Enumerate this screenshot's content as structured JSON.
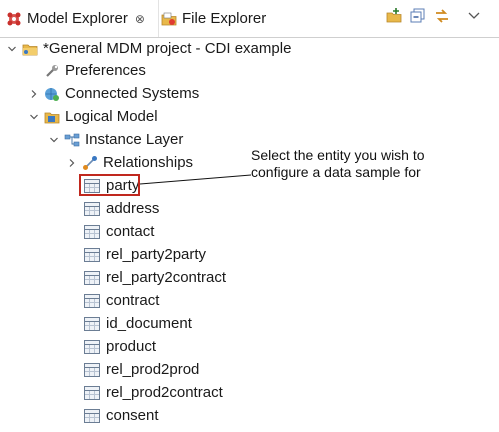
{
  "tabs": [
    {
      "label": "Model Explorer",
      "close": "⊗",
      "icon": "model-explorer-icon"
    },
    {
      "label": "File Explorer",
      "icon": "file-explorer-icon"
    }
  ],
  "toolbar": {
    "icons": [
      "folder-new-icon",
      "collapse-all-icon",
      "link-with-editor-icon",
      "view-menu-icon"
    ]
  },
  "tree": {
    "project": {
      "label": "*General MDM project - CDI example",
      "expanded": true
    },
    "preferences": {
      "label": "Preferences"
    },
    "connected_systems": {
      "label": "Connected Systems",
      "expanded": false
    },
    "logical_model": {
      "label": "Logical Model",
      "expanded": true
    },
    "instance_layer": {
      "label": "Instance Layer",
      "expanded": true
    },
    "relationships": {
      "label": "Relationships",
      "expanded": false
    },
    "entities": [
      {
        "label": "party"
      },
      {
        "label": "address"
      },
      {
        "label": "contact"
      },
      {
        "label": "rel_party2party"
      },
      {
        "label": "rel_party2contract"
      },
      {
        "label": "contract"
      },
      {
        "label": "id_document"
      },
      {
        "label": "product"
      },
      {
        "label": "rel_prod2prod"
      },
      {
        "label": "rel_prod2contract"
      },
      {
        "label": "consent"
      }
    ]
  },
  "callout": {
    "line1": "Select the entity you wish to",
    "line2": "configure a data sample for"
  },
  "colors": {
    "highlight": "#c0281e",
    "tab_border": "#cfcfcf"
  }
}
